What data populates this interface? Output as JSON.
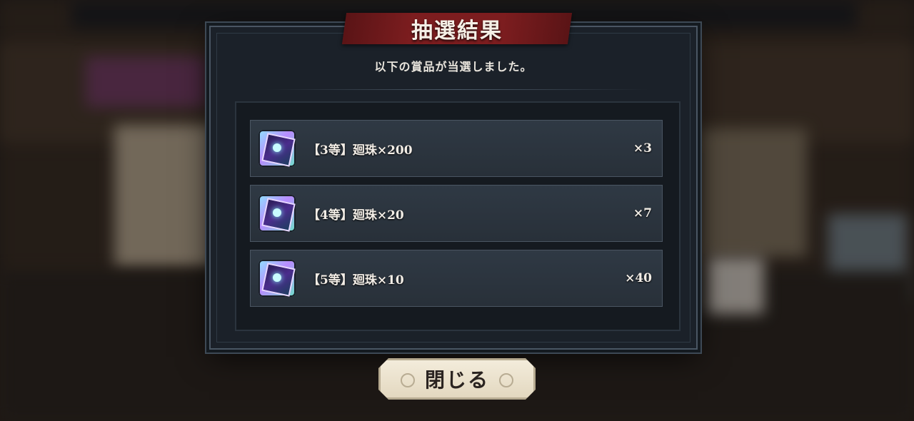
{
  "dialog": {
    "title": "抽選結果",
    "subtitle": "以下の賞品が当選しました。"
  },
  "prizes": [
    {
      "label": "【3等】廻珠×200",
      "qty": "×3",
      "icon": "gem-cube-icon"
    },
    {
      "label": "【4等】廻珠×20",
      "qty": "×7",
      "icon": "gem-cube-icon"
    },
    {
      "label": "【5等】廻珠×10",
      "qty": "×40",
      "icon": "gem-cube-icon"
    }
  ],
  "close_button": {
    "label": "閉じる"
  },
  "colors": {
    "banner": "#7c1d1f",
    "panel": "#1b2129",
    "row": "#2f3944",
    "button": "#f3ecdb"
  }
}
